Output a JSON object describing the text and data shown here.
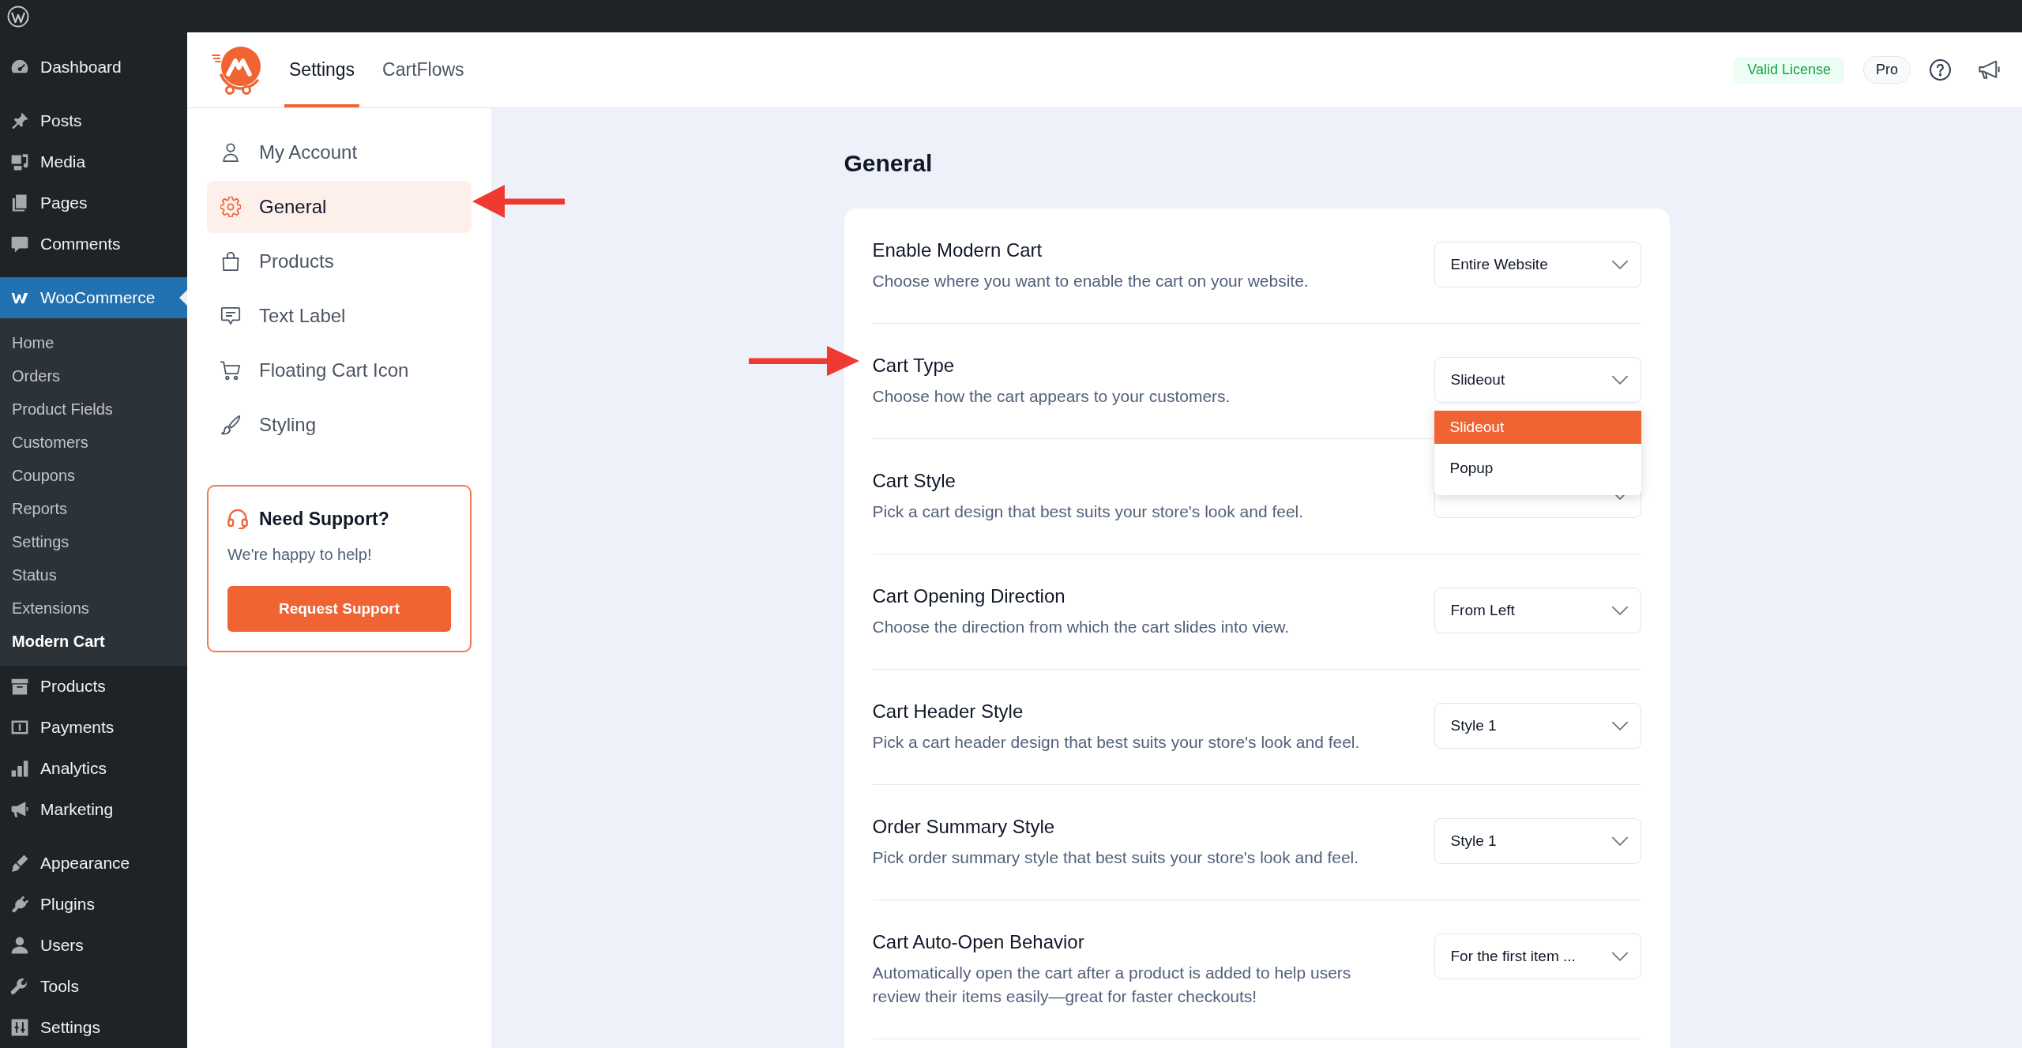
{
  "admin_menu": {
    "groups": [
      {
        "items": [
          {
            "label": "Dashboard",
            "selected": false
          }
        ]
      },
      {
        "items": [
          {
            "label": "Posts",
            "selected": false
          },
          {
            "label": "Media",
            "selected": false
          },
          {
            "label": "Pages",
            "selected": false
          },
          {
            "label": "Comments",
            "selected": false
          }
        ]
      },
      {
        "items": [
          {
            "label": "WooCommerce",
            "selected": true,
            "expanded": true,
            "children": [
              {
                "label": "Home",
                "selected": false
              },
              {
                "label": "Orders",
                "selected": false
              },
              {
                "label": "Product Fields",
                "selected": false
              },
              {
                "label": "Customers",
                "selected": false
              },
              {
                "label": "Coupons",
                "selected": false
              },
              {
                "label": "Reports",
                "selected": false
              },
              {
                "label": "Settings",
                "selected": false
              },
              {
                "label": "Status",
                "selected": false
              },
              {
                "label": "Extensions",
                "selected": false
              },
              {
                "label": "Modern Cart",
                "selected": true
              }
            ]
          },
          {
            "label": "Products",
            "selected": false
          },
          {
            "label": "Payments",
            "selected": false
          },
          {
            "label": "Analytics",
            "selected": false
          },
          {
            "label": "Marketing",
            "selected": false
          }
        ]
      },
      {
        "items": [
          {
            "label": "Appearance",
            "selected": false
          },
          {
            "label": "Plugins",
            "selected": false
          },
          {
            "label": "Users",
            "selected": false
          },
          {
            "label": "Tools",
            "selected": false
          },
          {
            "label": "Settings",
            "selected": false
          }
        ]
      }
    ]
  },
  "plugin_header": {
    "tabs": [
      {
        "label": "Settings",
        "selected": true
      },
      {
        "label": "CartFlows",
        "selected": false
      }
    ],
    "license_badge": "Valid License",
    "plan_badge": "Pro"
  },
  "settings_nav": {
    "items": [
      {
        "label": "My Account",
        "selected": false,
        "marked": false
      },
      {
        "label": "General",
        "selected": true,
        "marked": true
      },
      {
        "label": "Products",
        "selected": false,
        "marked": false
      },
      {
        "label": "Text Label",
        "selected": false,
        "marked": false
      },
      {
        "label": "Floating Cart Icon",
        "selected": false,
        "marked": false
      },
      {
        "label": "Styling",
        "selected": false,
        "marked": false
      }
    ],
    "support": {
      "title": "Need Support?",
      "text": "We're happy to help!",
      "button": "Request Support"
    }
  },
  "general": {
    "heading": "General",
    "settings": [
      {
        "title": "Enable Modern Cart",
        "description": "Choose where you want to enable the cart on your website.",
        "value": "Entire Website",
        "expanded": false,
        "marked": false
      },
      {
        "title": "Cart Type",
        "description": "Choose how the cart appears to your customers.",
        "value": "Slideout",
        "expanded": true,
        "marked": true,
        "options": [
          {
            "label": "Slideout",
            "selected": true
          },
          {
            "label": "Popup",
            "selected": false
          }
        ]
      },
      {
        "title": "Cart Style",
        "description": "Pick a cart design that best suits your store's look and feel.",
        "expanded": false,
        "marked": false
      },
      {
        "title": "Cart Opening Direction",
        "description": "Choose the direction from which the cart slides into view.",
        "value": "From Left",
        "expanded": false,
        "marked": false
      },
      {
        "title": "Cart Header Style",
        "description": "Pick a cart header design that best suits your store's look and feel.",
        "value": "Style 1",
        "expanded": false,
        "marked": false
      },
      {
        "title": "Order Summary Style",
        "description": "Pick order summary style that best suits your store's look and feel.",
        "value": "Style 1",
        "expanded": false,
        "marked": false
      },
      {
        "title": "Cart Auto-Open Behavior",
        "description": "Automatically open the cart after a product is added to help users review their items easily—great for faster checkouts!",
        "value": "For the first item ...",
        "expanded": false,
        "marked": false
      }
    ]
  }
}
